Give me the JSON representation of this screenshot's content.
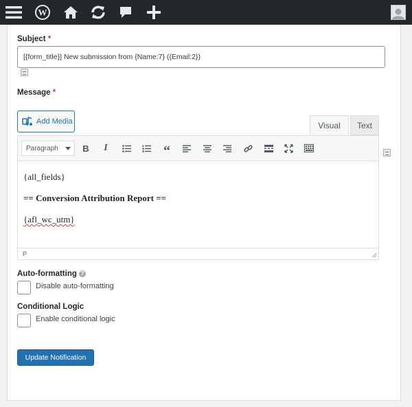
{
  "adminbar": {
    "icons": [
      "menu-icon",
      "wordpress-logo-icon",
      "home-icon",
      "updates-icon",
      "comments-icon",
      "plus-icon",
      "avatar-icon"
    ]
  },
  "subject": {
    "label": "Subject",
    "required_mark": "*",
    "value": "[{form_title}] New submission from {Name:7} ({Email:2})"
  },
  "message": {
    "label": "Message",
    "required_mark": "*",
    "add_media_label": "Add Media",
    "tabs": {
      "visual": "Visual",
      "text": "Text"
    },
    "toolbar": {
      "format_select": "Paragraph",
      "buttons": [
        "bold",
        "italic",
        "bulleted-list",
        "numbered-list",
        "blockquote",
        "align-left",
        "align-center",
        "align-right",
        "insert-link",
        "read-more",
        "fullscreen",
        "toolbar-toggle"
      ]
    },
    "content": {
      "line1": "{all_fields}",
      "line2": "== Conversion Attribution Report ==",
      "line3": "{afl_wc_utm}"
    },
    "status_path": "P"
  },
  "auto_formatting": {
    "label": "Auto-formatting",
    "checkbox_label": "Disable auto-formatting",
    "checked": false
  },
  "conditional_logic": {
    "label": "Conditional Logic",
    "checkbox_label": "Enable conditional logic",
    "checked": false
  },
  "submit": {
    "label": "Update Notification"
  },
  "colors": {
    "adminbar": "#23282d",
    "primary": "#2271b1",
    "required": "#d63638"
  }
}
